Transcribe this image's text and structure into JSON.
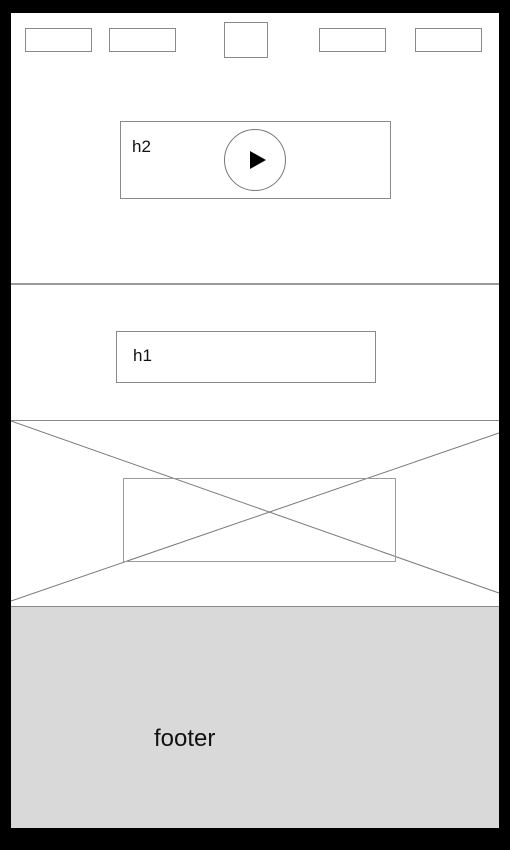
{
  "header": {
    "nav_items": [
      "",
      "",
      "",
      ""
    ],
    "logo": ""
  },
  "hero": {
    "heading": "h2",
    "play_icon": "play-icon"
  },
  "section": {
    "heading": "h1"
  },
  "image": {
    "placeholder_icon": "image-placeholder-cross"
  },
  "footer": {
    "label": "footer"
  },
  "colors": {
    "frame_bg": "#ffffff",
    "outer_bg": "#000000",
    "footer_bg": "#d9d9d9",
    "outline": "#8a8a8a"
  }
}
